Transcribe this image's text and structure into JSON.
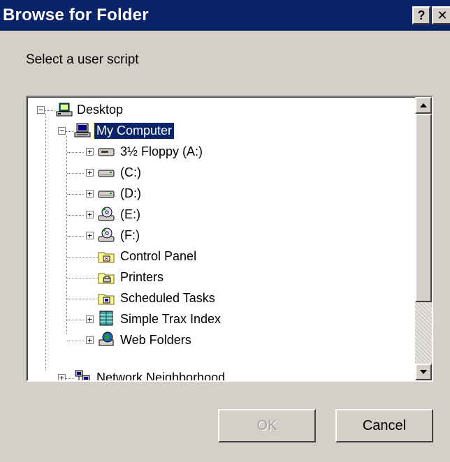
{
  "window": {
    "title": "Browse for Folder",
    "help_glyph": "?",
    "close_glyph": "✕"
  },
  "prompt": "Select a user script",
  "tree": {
    "items": [
      {
        "label": "Desktop",
        "icon": "desktop-icon",
        "expander": "−"
      },
      {
        "label": "My Computer",
        "icon": "computer-icon",
        "expander": "−",
        "selected": true
      },
      {
        "label": "3½ Floppy (A:)",
        "icon": "floppy-drive-icon",
        "expander": "+"
      },
      {
        "label": "(C:)",
        "icon": "hard-drive-icon",
        "expander": "+"
      },
      {
        "label": "(D:)",
        "icon": "hard-drive-icon",
        "expander": "+"
      },
      {
        "label": "(E:)",
        "icon": "cd-drive-icon",
        "expander": "+"
      },
      {
        "label": "(F:)",
        "icon": "cd-drive-icon",
        "expander": "+"
      },
      {
        "label": "Control Panel",
        "icon": "control-panel-icon",
        "expander": ""
      },
      {
        "label": "Printers",
        "icon": "printers-icon",
        "expander": ""
      },
      {
        "label": "Scheduled Tasks",
        "icon": "scheduled-tasks-icon",
        "expander": ""
      },
      {
        "label": "Simple Trax Index",
        "icon": "database-icon",
        "expander": "+"
      },
      {
        "label": "Web Folders",
        "icon": "web-folders-icon",
        "expander": "+"
      },
      {
        "label": "Network Neighborhood",
        "icon": "network-icon",
        "expander": "+"
      }
    ]
  },
  "buttons": {
    "ok": "OK",
    "cancel": "Cancel"
  },
  "colors": {
    "titlebar": "#0a246a",
    "dialog_face": "#d4d0c8",
    "selection": "#0a246a"
  }
}
